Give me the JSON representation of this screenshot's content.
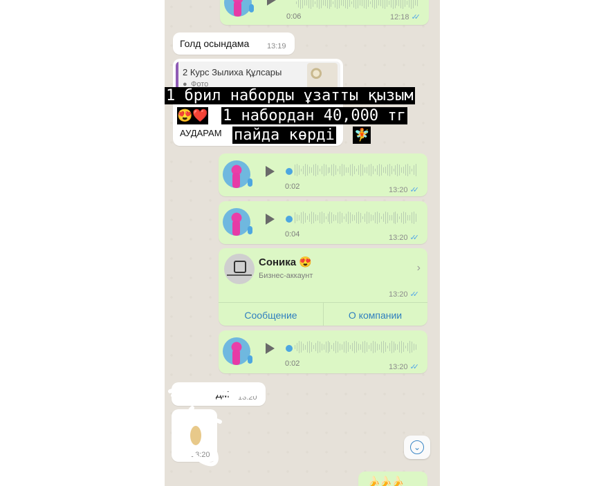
{
  "messages": {
    "voice_top": {
      "duration": "0:06",
      "time": "12:18"
    },
    "text_gold": {
      "text": "Голд осындама",
      "time": "13:19"
    },
    "reply": {
      "title": "2 Курс Зылиха Құлсары",
      "subtitle": "Фото"
    },
    "partial_text": {
      "text": "АУДАРАМ"
    },
    "voice_1": {
      "duration": "0:02",
      "time": "13:20"
    },
    "voice_2": {
      "duration": "0:04",
      "time": "13:20"
    },
    "business": {
      "name": "Соника",
      "subtitle": "Бизнес-аккаунт",
      "time": "13:20",
      "message_button": "Сообщение",
      "about_button": "О компании"
    },
    "voice_3": {
      "duration": "0:02",
      "time": "13:20"
    },
    "scribbled_1": {
      "text": "ДМ",
      "time": "13:20"
    },
    "scribbled_2": {
      "time": "13:20"
    }
  },
  "captions": {
    "line1": "1 брил наборды ұзатты қызым",
    "line2_emoji": "😍❤️",
    "line2": "1 набордан 40,000 тг",
    "line3": "пайда көрді",
    "line3_emoji": "🧚"
  },
  "icons": {
    "play": "play-icon",
    "mic": "microphone-icon",
    "ticks": "double-check-icon",
    "chevron": "chevron-right-icon",
    "scroll": "scroll-down-icon"
  },
  "colors": {
    "outgoing": "#dcf7c5",
    "incoming": "#ffffff",
    "accent": "#3a86c5",
    "caption_bg": "#000000"
  }
}
